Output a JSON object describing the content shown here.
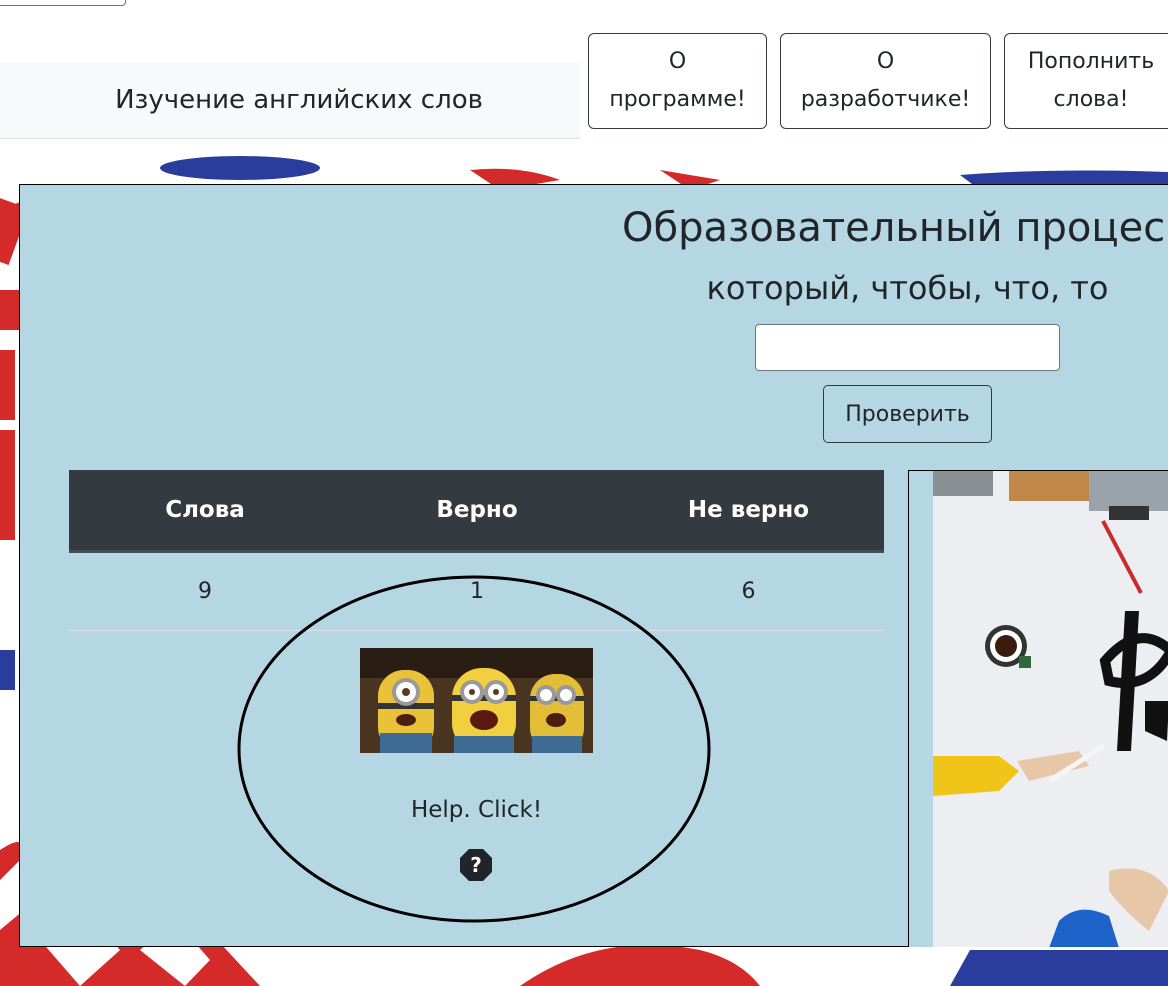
{
  "header": {
    "brand": "Изучение английских слов",
    "nav": [
      {
        "line1": "О",
        "line2": "программе!"
      },
      {
        "line1": "О",
        "line2": "разработчике!"
      },
      {
        "line1": "Пополнить",
        "line2": "слова!"
      }
    ]
  },
  "quiz": {
    "title": "Образовательный процес",
    "word": "который, чтобы, что, то",
    "input_value": "",
    "input_placeholder": "",
    "check_label": "Проверить"
  },
  "stats": {
    "headers": [
      "Слова",
      "Верно",
      "Не верно"
    ],
    "values": [
      "9",
      "1",
      "6"
    ]
  },
  "help": {
    "label": "Help. Click!",
    "icon": "question-circle-icon"
  },
  "colors": {
    "card_bg": "#b5d6e3",
    "table_header": "#343a40"
  }
}
